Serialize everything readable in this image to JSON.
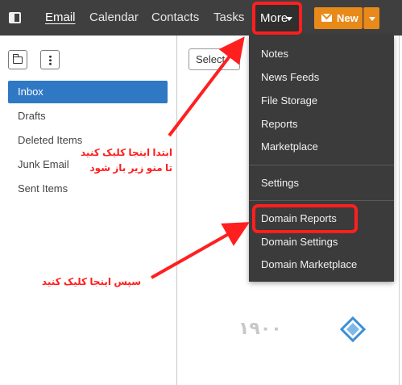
{
  "nav": {
    "panel_toggle_icon": "sidebar-panel-icon",
    "items": [
      {
        "label": "Email"
      },
      {
        "label": "Calendar"
      },
      {
        "label": "Contacts"
      },
      {
        "label": "Tasks"
      }
    ],
    "more_label": "More",
    "new_label": "New",
    "new_icon": "envelope-icon"
  },
  "colors": {
    "topbar": "#3f3f3f",
    "accent_blue": "#2f78c4",
    "new_button": "#e88a1a",
    "menu_bg": "#3b3b3b",
    "annotation_red": "#ff1f1f"
  },
  "folders": {
    "selected": "Inbox",
    "items": [
      {
        "label": "Inbox"
      },
      {
        "label": "Drafts"
      },
      {
        "label": "Deleted Items"
      },
      {
        "label": "Junk Email"
      },
      {
        "label": "Sent Items"
      }
    ]
  },
  "list": {
    "select_label": "Select"
  },
  "more_menu": {
    "items": [
      {
        "label": "Notes"
      },
      {
        "label": "News Feeds"
      },
      {
        "label": "File Storage"
      },
      {
        "label": "Reports"
      },
      {
        "label": "Marketplace"
      },
      {
        "label": "Settings"
      },
      {
        "label": "Domain Reports"
      },
      {
        "label": "Domain Settings"
      },
      {
        "label": "Domain Marketplace"
      }
    ]
  },
  "annotations": {
    "first_line1": "ابتدا اینجا کلیک کنید",
    "first_line2": "تا منو زیر باز شود",
    "then": "سپس اینجا کلیک کنید"
  },
  "watermark": {
    "text": "۱۹۰۰"
  }
}
